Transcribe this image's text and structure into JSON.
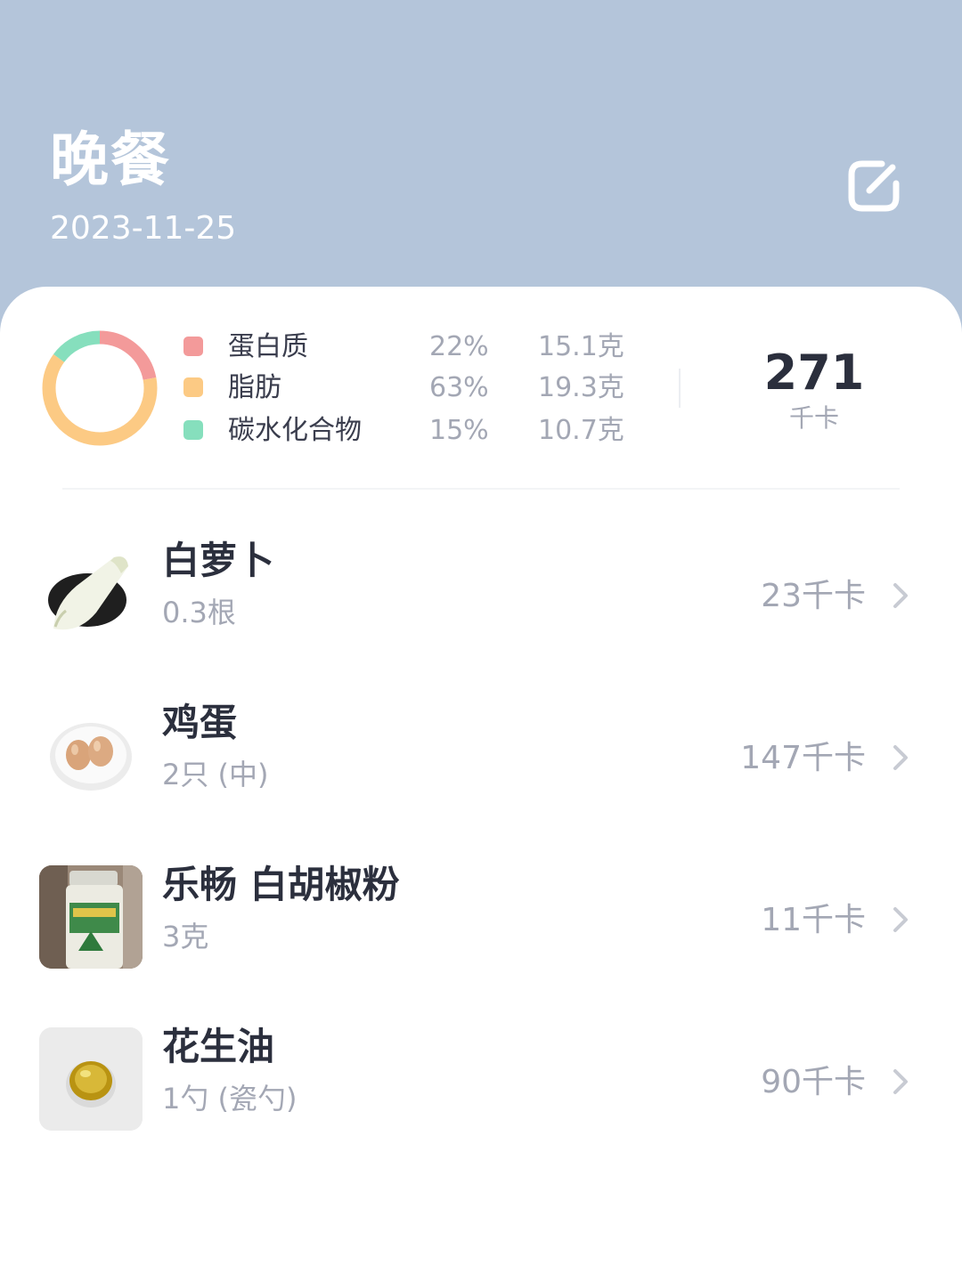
{
  "header": {
    "title": "晚餐",
    "date": "2023-11-25"
  },
  "icons": {
    "edit": "edit-square-pencil-icon",
    "chevron": "chevron-right-icon"
  },
  "summary": {
    "macros": [
      {
        "name": "蛋白质",
        "percent": "22%",
        "grams": "15.1克",
        "color": "#f39a9a"
      },
      {
        "name": "脂肪",
        "percent": "63%",
        "grams": "19.3克",
        "color": "#fcca84"
      },
      {
        "name": "碳水化合物",
        "percent": "15%",
        "grams": "10.7克",
        "color": "#86dfbd"
      }
    ],
    "total_kcal": "271",
    "total_unit": "千卡"
  },
  "chart_data": {
    "type": "pie",
    "categories": [
      "蛋白质",
      "脂肪",
      "碳水化合物"
    ],
    "values": [
      22,
      63,
      15
    ],
    "colors": [
      "#f39a9a",
      "#fcca84",
      "#86dfbd"
    ]
  },
  "foods": [
    {
      "name": "白萝卜",
      "amount": "0.3根",
      "kcal": "23千卡"
    },
    {
      "name": "鸡蛋",
      "amount": "2只 (中)",
      "kcal": "147千卡"
    },
    {
      "name": "乐畅 白胡椒粉",
      "amount": "3克",
      "kcal": "11千卡"
    },
    {
      "name": "花生油",
      "amount": "1勺 (瓷勺)",
      "kcal": "90千卡"
    }
  ]
}
